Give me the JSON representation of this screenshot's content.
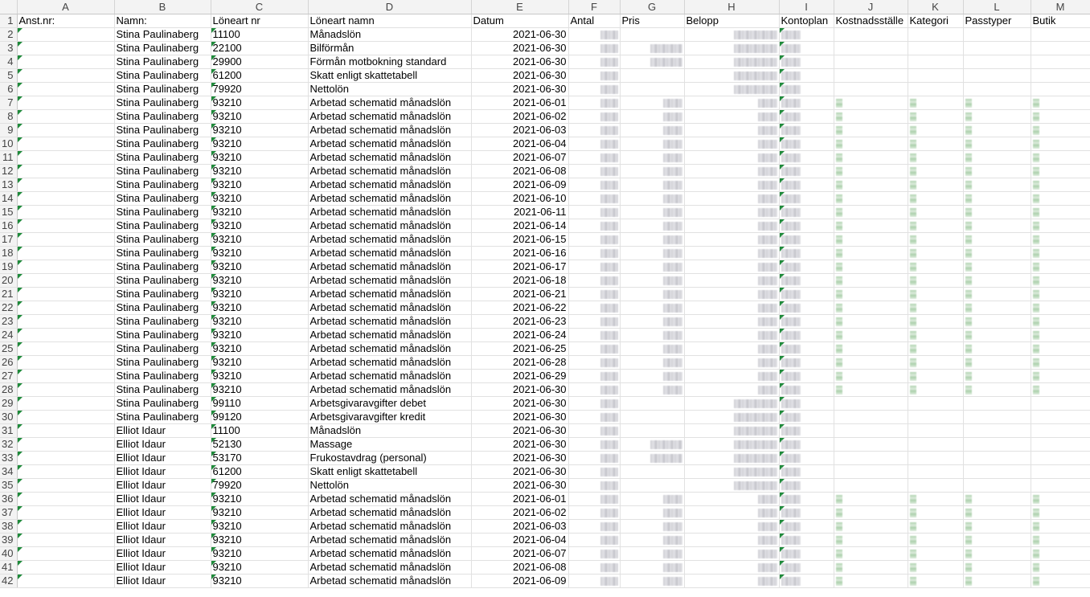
{
  "columns": [
    "A",
    "B",
    "C",
    "D",
    "E",
    "F",
    "G",
    "H",
    "I",
    "J",
    "K",
    "L",
    "M"
  ],
  "headers": [
    "Anst.nr:",
    "Namn:",
    "Löneart nr",
    "Löneart namn",
    "Datum",
    "Antal",
    "Pris",
    "Belopp",
    "Kontoplan",
    "Kostnadsställe",
    "Kategori",
    "Passtyper",
    "Butik"
  ],
  "rows": [
    {
      "n": "2",
      "name": "Stina Paulinaberg",
      "code": "11100",
      "desc": "Månadslön",
      "date": "2021-06-30"
    },
    {
      "n": "3",
      "name": "Stina Paulinaberg",
      "code": "22100",
      "desc": "Bilförmån",
      "date": "2021-06-30"
    },
    {
      "n": "4",
      "name": "Stina Paulinaberg",
      "code": "29900",
      "desc": "Förmån motbokning standard",
      "date": "2021-06-30"
    },
    {
      "n": "5",
      "name": "Stina Paulinaberg",
      "code": "61200",
      "desc": "Skatt enligt skattetabell",
      "date": "2021-06-30"
    },
    {
      "n": "6",
      "name": "Stina Paulinaberg",
      "code": "79920",
      "desc": "Nettolön",
      "date": "2021-06-30"
    },
    {
      "n": "7",
      "name": "Stina Paulinaberg",
      "code": "93210",
      "desc": "Arbetad schematid månadslön",
      "date": "2021-06-01"
    },
    {
      "n": "8",
      "name": "Stina Paulinaberg",
      "code": "93210",
      "desc": "Arbetad schematid månadslön",
      "date": "2021-06-02"
    },
    {
      "n": "9",
      "name": "Stina Paulinaberg",
      "code": "93210",
      "desc": "Arbetad schematid månadslön",
      "date": "2021-06-03"
    },
    {
      "n": "10",
      "name": "Stina Paulinaberg",
      "code": "93210",
      "desc": "Arbetad schematid månadslön",
      "date": "2021-06-04"
    },
    {
      "n": "11",
      "name": "Stina Paulinaberg",
      "code": "93210",
      "desc": "Arbetad schematid månadslön",
      "date": "2021-06-07"
    },
    {
      "n": "12",
      "name": "Stina Paulinaberg",
      "code": "93210",
      "desc": "Arbetad schematid månadslön",
      "date": "2021-06-08"
    },
    {
      "n": "13",
      "name": "Stina Paulinaberg",
      "code": "93210",
      "desc": "Arbetad schematid månadslön",
      "date": "2021-06-09"
    },
    {
      "n": "14",
      "name": "Stina Paulinaberg",
      "code": "93210",
      "desc": "Arbetad schematid månadslön",
      "date": "2021-06-10"
    },
    {
      "n": "15",
      "name": "Stina Paulinaberg",
      "code": "93210",
      "desc": "Arbetad schematid månadslön",
      "date": "2021-06-11"
    },
    {
      "n": "16",
      "name": "Stina Paulinaberg",
      "code": "93210",
      "desc": "Arbetad schematid månadslön",
      "date": "2021-06-14"
    },
    {
      "n": "17",
      "name": "Stina Paulinaberg",
      "code": "93210",
      "desc": "Arbetad schematid månadslön",
      "date": "2021-06-15"
    },
    {
      "n": "18",
      "name": "Stina Paulinaberg",
      "code": "93210",
      "desc": "Arbetad schematid månadslön",
      "date": "2021-06-16"
    },
    {
      "n": "19",
      "name": "Stina Paulinaberg",
      "code": "93210",
      "desc": "Arbetad schematid månadslön",
      "date": "2021-06-17"
    },
    {
      "n": "20",
      "name": "Stina Paulinaberg",
      "code": "93210",
      "desc": "Arbetad schematid månadslön",
      "date": "2021-06-18"
    },
    {
      "n": "21",
      "name": "Stina Paulinaberg",
      "code": "93210",
      "desc": "Arbetad schematid månadslön",
      "date": "2021-06-21"
    },
    {
      "n": "22",
      "name": "Stina Paulinaberg",
      "code": "93210",
      "desc": "Arbetad schematid månadslön",
      "date": "2021-06-22"
    },
    {
      "n": "23",
      "name": "Stina Paulinaberg",
      "code": "93210",
      "desc": "Arbetad schematid månadslön",
      "date": "2021-06-23"
    },
    {
      "n": "24",
      "name": "Stina Paulinaberg",
      "code": "93210",
      "desc": "Arbetad schematid månadslön",
      "date": "2021-06-24"
    },
    {
      "n": "25",
      "name": "Stina Paulinaberg",
      "code": "93210",
      "desc": "Arbetad schematid månadslön",
      "date": "2021-06-25"
    },
    {
      "n": "26",
      "name": "Stina Paulinaberg",
      "code": "93210",
      "desc": "Arbetad schematid månadslön",
      "date": "2021-06-28"
    },
    {
      "n": "27",
      "name": "Stina Paulinaberg",
      "code": "93210",
      "desc": "Arbetad schematid månadslön",
      "date": "2021-06-29"
    },
    {
      "n": "28",
      "name": "Stina Paulinaberg",
      "code": "93210",
      "desc": "Arbetad schematid månadslön",
      "date": "2021-06-30"
    },
    {
      "n": "29",
      "name": "Stina Paulinaberg",
      "code": "99110",
      "desc": "Arbetsgivaravgifter debet",
      "date": "2021-06-30"
    },
    {
      "n": "30",
      "name": "Stina Paulinaberg",
      "code": "99120",
      "desc": "Arbetsgivaravgifter kredit",
      "date": "2021-06-30"
    },
    {
      "n": "31",
      "name": "Elliot Idaur",
      "code": "11100",
      "desc": "Månadslön",
      "date": "2021-06-30"
    },
    {
      "n": "32",
      "name": "Elliot Idaur",
      "code": "52130",
      "desc": "Massage",
      "date": "2021-06-30"
    },
    {
      "n": "33",
      "name": "Elliot Idaur",
      "code": "53170",
      "desc": "Frukostavdrag (personal)",
      "date": "2021-06-30"
    },
    {
      "n": "34",
      "name": "Elliot Idaur",
      "code": "61200",
      "desc": "Skatt enligt skattetabell",
      "date": "2021-06-30"
    },
    {
      "n": "35",
      "name": "Elliot Idaur",
      "code": "79920",
      "desc": "Nettolön",
      "date": "2021-06-30"
    },
    {
      "n": "36",
      "name": "Elliot Idaur",
      "code": "93210",
      "desc": "Arbetad schematid månadslön",
      "date": "2021-06-01"
    },
    {
      "n": "37",
      "name": "Elliot Idaur",
      "code": "93210",
      "desc": "Arbetad schematid månadslön",
      "date": "2021-06-02"
    },
    {
      "n": "38",
      "name": "Elliot Idaur",
      "code": "93210",
      "desc": "Arbetad schematid månadslön",
      "date": "2021-06-03"
    },
    {
      "n": "39",
      "name": "Elliot Idaur",
      "code": "93210",
      "desc": "Arbetad schematid månadslön",
      "date": "2021-06-04"
    },
    {
      "n": "40",
      "name": "Elliot Idaur",
      "code": "93210",
      "desc": "Arbetad schematid månadslön",
      "date": "2021-06-07"
    },
    {
      "n": "41",
      "name": "Elliot Idaur",
      "code": "93210",
      "desc": "Arbetad schematid månadslön",
      "date": "2021-06-08"
    },
    {
      "n": "42",
      "name": "Elliot Idaur",
      "code": "93210",
      "desc": "Arbetad schematid månadslön",
      "date": "2021-06-09"
    }
  ]
}
